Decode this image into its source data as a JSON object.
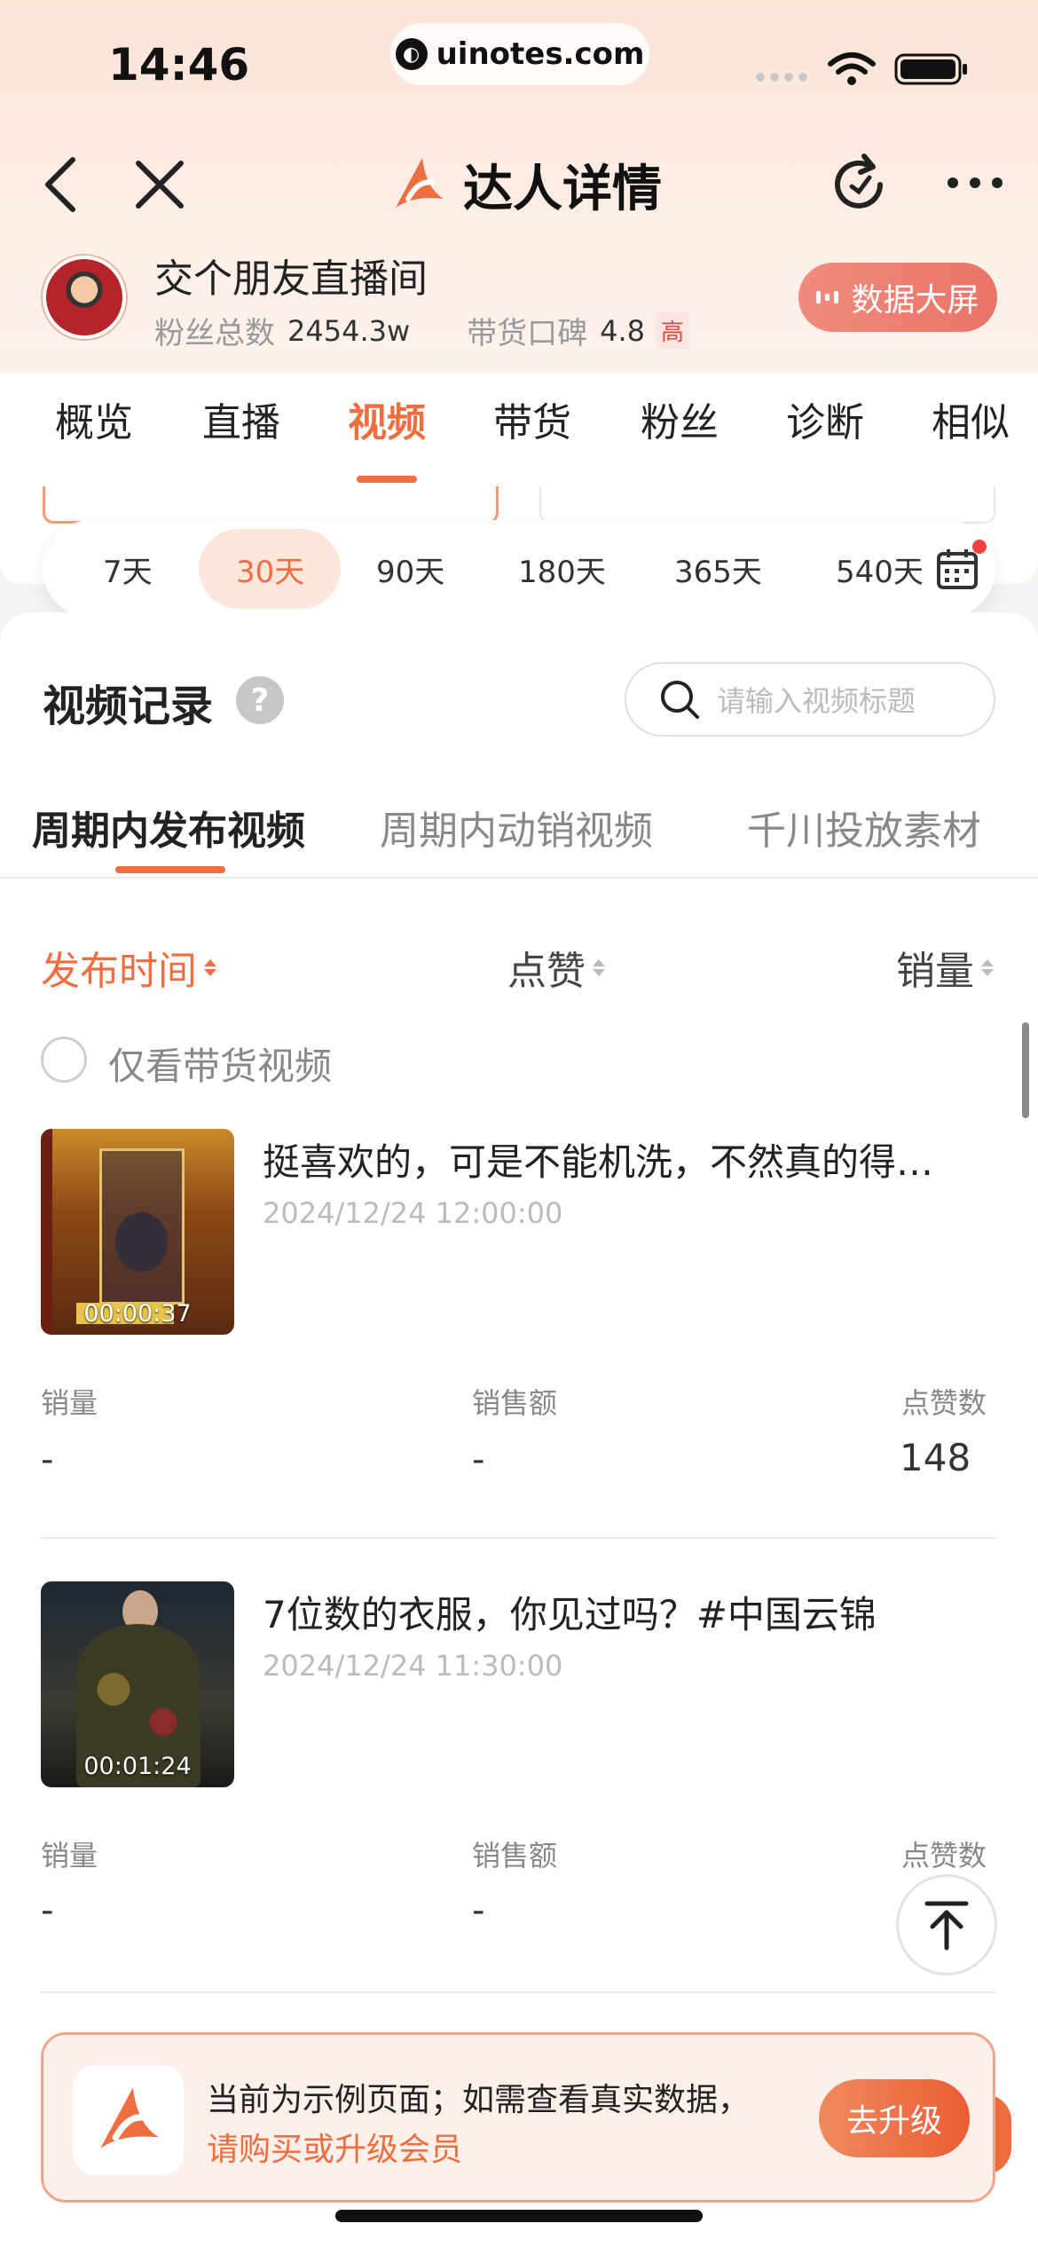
{
  "status_bar": {
    "time": "14:46",
    "url": "uinotes.com"
  },
  "nav": {
    "title": "达人详情"
  },
  "profile": {
    "name": "交个朋友直播间",
    "fans_label": "粉丝总数",
    "fans_value": "2454.3w",
    "reputation_label": "带货口碑",
    "reputation_value": "4.8",
    "reputation_level": "高",
    "data_screen_button": "数据大屏"
  },
  "tabs": [
    "概览",
    "直播",
    "视频",
    "带货",
    "粉丝",
    "诊断",
    "相似"
  ],
  "active_tab": "视频",
  "periods": [
    "7天",
    "30天",
    "90天",
    "180天",
    "365天",
    "540天"
  ],
  "active_period": "30天",
  "records": {
    "title": "视频记录",
    "help": "?",
    "search_placeholder": "请输入视频标题",
    "sub_tabs": [
      "周期内发布视频",
      "周期内动销视频",
      "千川投放素材"
    ],
    "sort": {
      "time": "发布时间",
      "likes": "点赞",
      "sales": "销量"
    },
    "only_selling_label": "仅看带货视频"
  },
  "videos": [
    {
      "title": "挺喜欢的，可是不能机洗，不然真的得…",
      "date": "2024/12/24 12:00:00",
      "duration": "00:00:37",
      "sales_label": "销量",
      "sales": "-",
      "revenue_label": "销售额",
      "revenue": "-",
      "likes_label": "点赞数",
      "likes": "148"
    },
    {
      "title": "7位数的衣服，你见过吗？#中国云锦",
      "date": "2024/12/24 11:30:00",
      "duration": "00:01:24",
      "sales_label": "销量",
      "sales": "-",
      "revenue_label": "销售额",
      "revenue": "-",
      "likes_label": "点赞数",
      "likes": ""
    }
  ],
  "banner": {
    "line1": "当前为示例页面；如需查看真实数据，",
    "line2": "请购买或升级会员",
    "button": "去升级"
  },
  "colors": {
    "accent": "#ef6e40",
    "badge_red": "#e8443a"
  }
}
